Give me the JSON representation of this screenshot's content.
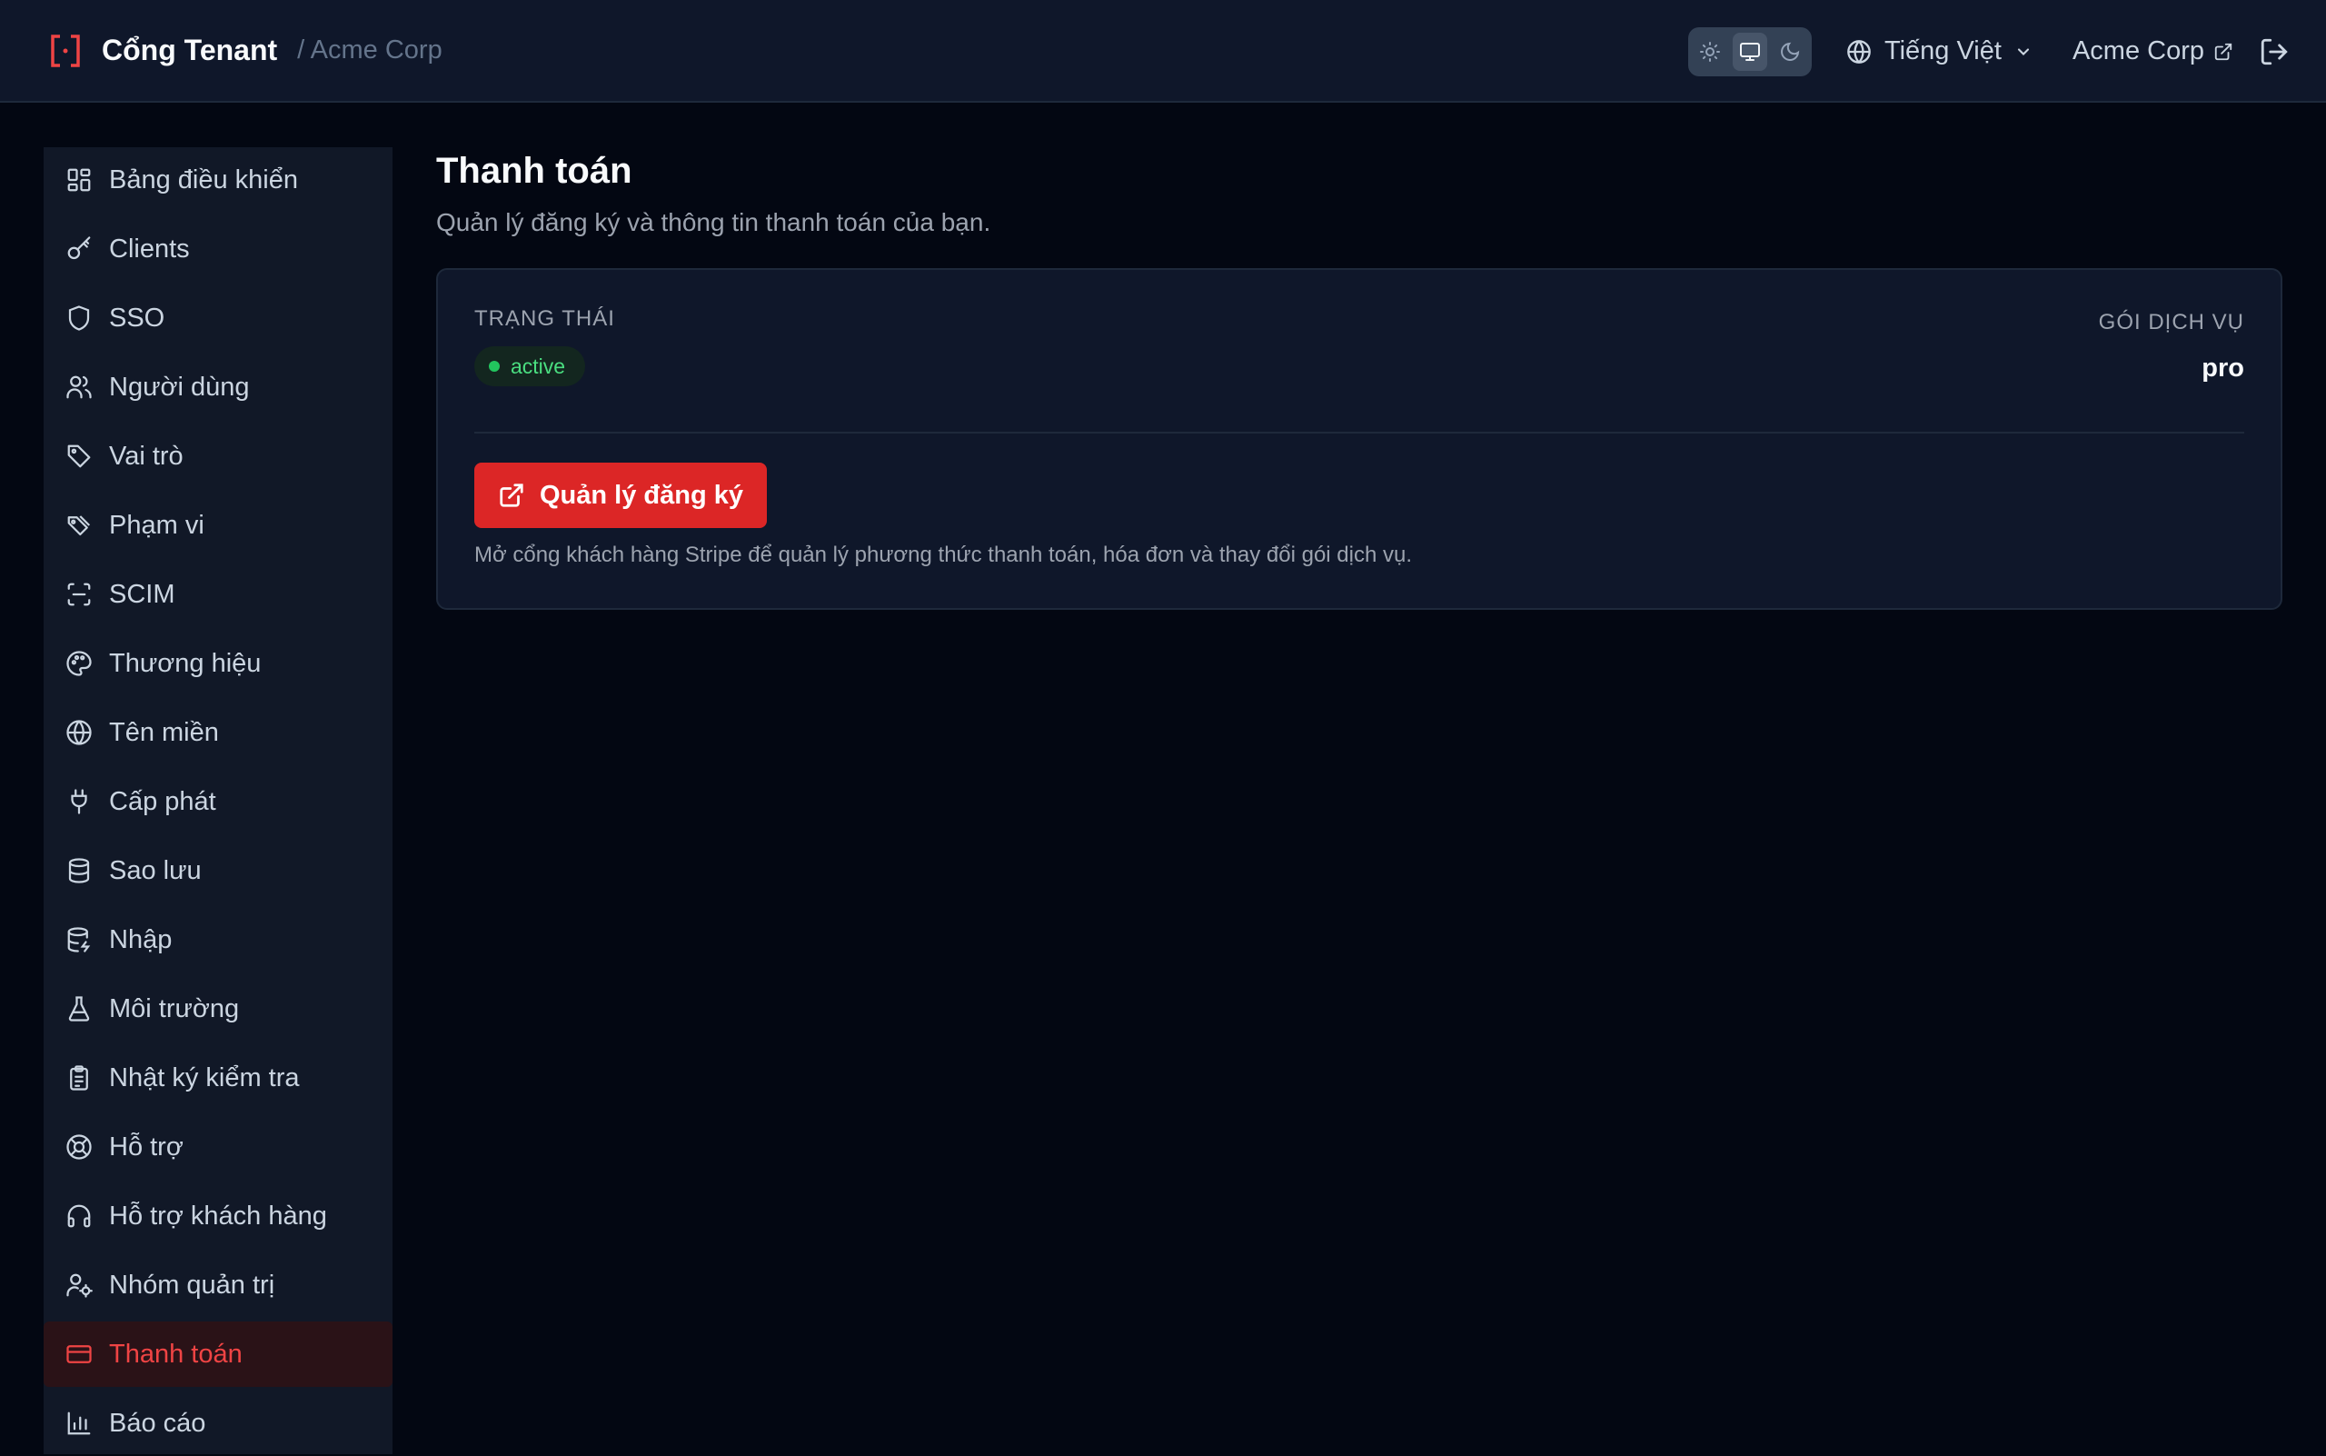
{
  "header": {
    "title": "Cổng Tenant",
    "tenant": "/ Acme Corp",
    "language": "Tiếng Việt",
    "org_link": "Acme Corp"
  },
  "colors": {
    "accent": "#dc2626",
    "active_text": "#ef4444",
    "status_green": "#4ade80"
  },
  "sidebar": {
    "items": [
      {
        "label": "Bảng điều khiển",
        "icon": "dashboard-icon"
      },
      {
        "label": "Clients",
        "icon": "key-icon"
      },
      {
        "label": "SSO",
        "icon": "shield-icon"
      },
      {
        "label": "Người dùng",
        "icon": "users-icon"
      },
      {
        "label": "Vai trò",
        "icon": "tag-icon"
      },
      {
        "label": "Phạm vi",
        "icon": "tags-icon"
      },
      {
        "label": "SCIM",
        "icon": "scan-icon"
      },
      {
        "label": "Thương hiệu",
        "icon": "palette-icon"
      },
      {
        "label": "Tên miền",
        "icon": "globe-icon"
      },
      {
        "label": "Cấp phát",
        "icon": "plug-icon"
      },
      {
        "label": "Sao lưu",
        "icon": "database-icon"
      },
      {
        "label": "Nhập",
        "icon": "database-import-icon"
      },
      {
        "label": "Môi trường",
        "icon": "flask-icon"
      },
      {
        "label": "Nhật ký kiểm tra",
        "icon": "clipboard-icon"
      },
      {
        "label": "Hỗ trợ",
        "icon": "lifebuoy-icon"
      },
      {
        "label": "Hỗ trợ khách hàng",
        "icon": "headset-icon"
      },
      {
        "label": "Nhóm quản trị",
        "icon": "user-cog-icon"
      },
      {
        "label": "Thanh toán",
        "icon": "credit-card-icon",
        "active": true
      },
      {
        "label": "Báo cáo",
        "icon": "bar-chart-icon"
      }
    ]
  },
  "main": {
    "title": "Thanh toán",
    "subtitle": "Quản lý đăng ký và thông tin thanh toán của bạn.",
    "status_label": "TRẠNG THÁI",
    "status_value": "active",
    "plan_label": "GÓI DỊCH VỤ",
    "plan_value": "pro",
    "manage_button": "Quản lý đăng ký",
    "helper_text": "Mở cổng khách hàng Stripe để quản lý phương thức thanh toán, hóa đơn và thay đổi gói dịch vụ."
  }
}
